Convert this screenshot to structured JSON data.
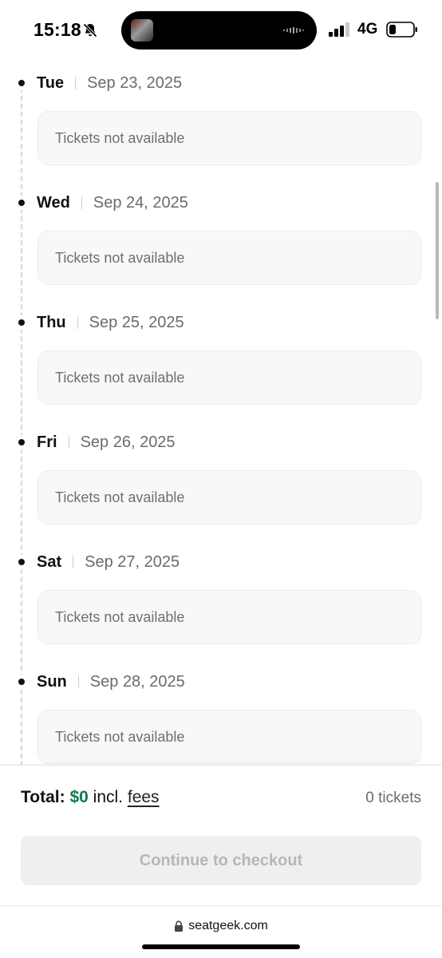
{
  "status_bar": {
    "time": "15:18",
    "network": "4G",
    "icons": [
      "bell-slash-icon",
      "signal-icon",
      "battery-icon"
    ]
  },
  "schedule": [
    {
      "day": "Tue",
      "date": "Sep 23, 2025",
      "status": "Tickets not available"
    },
    {
      "day": "Wed",
      "date": "Sep 24, 2025",
      "status": "Tickets not available"
    },
    {
      "day": "Thu",
      "date": "Sep 25, 2025",
      "status": "Tickets not available"
    },
    {
      "day": "Fri",
      "date": "Sep 26, 2025",
      "status": "Tickets not available"
    },
    {
      "day": "Sat",
      "date": "Sep 27, 2025",
      "status": "Tickets not available"
    },
    {
      "day": "Sun",
      "date": "Sep 28, 2025",
      "status": "Tickets not available"
    }
  ],
  "footer": {
    "total_label": "Total:",
    "total_amount": "$0",
    "incl_text": "incl.",
    "fees_link": "fees",
    "ticket_count": "0 tickets",
    "checkout_label": "Continue to checkout"
  },
  "browser": {
    "url": "seatgeek.com"
  },
  "colors": {
    "accent_green": "#127a4a",
    "card_bg": "#f8f8f8",
    "disabled_button_bg": "#efefef",
    "disabled_button_text": "#b7b7b7"
  }
}
